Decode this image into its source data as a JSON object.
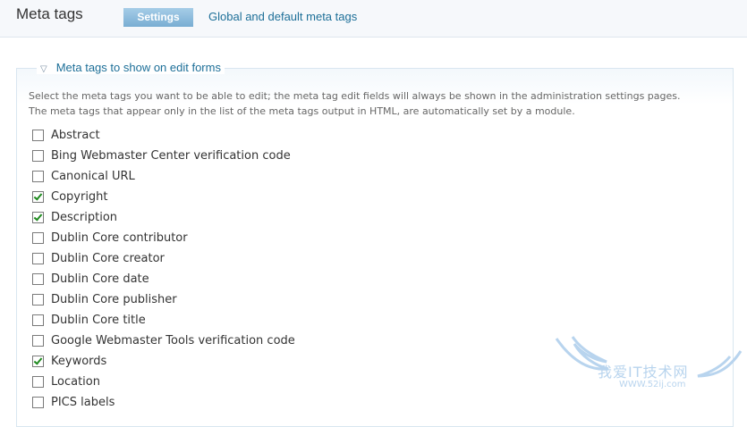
{
  "header": {
    "title": "Meta tags",
    "tabs": [
      {
        "label": "Settings",
        "active": true
      },
      {
        "label": "Global and default meta tags",
        "active": false
      }
    ]
  },
  "fieldset": {
    "legend": "Meta tags to show on edit forms",
    "legend_icon": "triangle-down-icon",
    "description_line1": "Select the meta tags you want to be able to edit; the meta tag edit fields will always be shown in the administration settings pages.",
    "description_line2": "The meta tags that appear only in the list of the meta tags output in HTML, are automatically set by a module.",
    "options": [
      {
        "label": "Abstract",
        "checked": false
      },
      {
        "label": "Bing Webmaster Center verification code",
        "checked": false
      },
      {
        "label": "Canonical URL",
        "checked": false
      },
      {
        "label": "Copyright",
        "checked": true
      },
      {
        "label": "Description",
        "checked": true
      },
      {
        "label": "Dublin Core contributor",
        "checked": false
      },
      {
        "label": "Dublin Core creator",
        "checked": false
      },
      {
        "label": "Dublin Core date",
        "checked": false
      },
      {
        "label": "Dublin Core publisher",
        "checked": false
      },
      {
        "label": "Dublin Core title",
        "checked": false
      },
      {
        "label": "Google Webmaster Tools verification code",
        "checked": false
      },
      {
        "label": "Keywords",
        "checked": true
      },
      {
        "label": "Location",
        "checked": false
      },
      {
        "label": "PICS labels",
        "checked": false
      }
    ]
  },
  "watermark": {
    "text": "我爱IT技术网",
    "sub": "WWW.52ij.com"
  },
  "colors": {
    "accent": "#1d6f98",
    "tab_active_bg": "#78add3",
    "check": "#1f8a1f"
  }
}
